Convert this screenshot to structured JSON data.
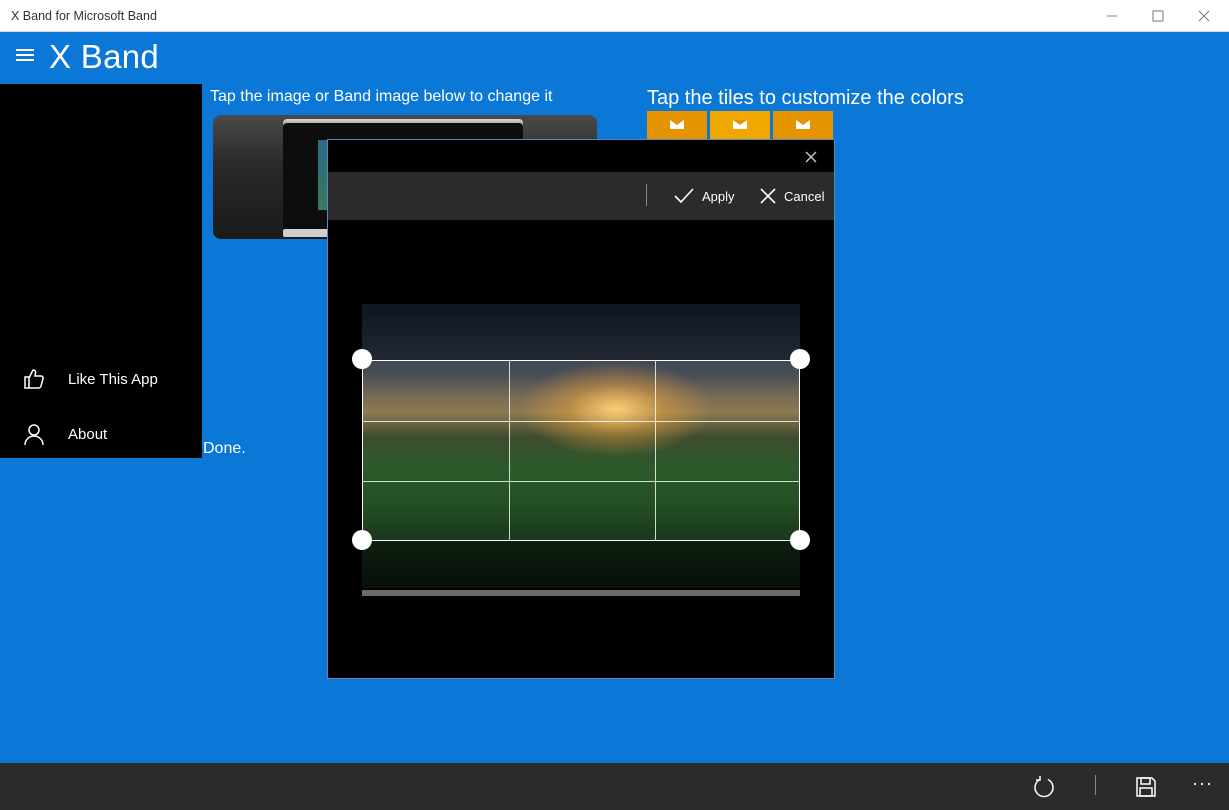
{
  "window": {
    "title": "X Band for Microsoft Band",
    "controls": [
      "minimize-icon",
      "maximize-icon",
      "close-icon"
    ]
  },
  "header": {
    "menu_icon": "hamburger-icon",
    "app_title": "X Band"
  },
  "nav": {
    "items": [
      {
        "label": "Like This App",
        "icon": "thumbs-up-icon"
      },
      {
        "label": "About",
        "icon": "person-icon"
      }
    ]
  },
  "main": {
    "image_instruction": "Tap the image or Band image below to change it",
    "tiles_instruction": "Tap the tiles to customize the colors",
    "status_text": "Done.",
    "tile_colors": [
      "#e59400",
      "#f0a800",
      "#e59400"
    ],
    "tile_icon": "envelope-icon"
  },
  "crop_dialog": {
    "close_icon": "close-icon",
    "apply_label": "Apply",
    "cancel_label": "Cancel"
  },
  "appbar": {
    "buttons": [
      "refresh-icon",
      "save-icon",
      "more-icon"
    ],
    "more_label": "···"
  },
  "colors": {
    "background": "#0b78d7",
    "nav_pane": "#000000",
    "toolbar": "#2b2b2b"
  }
}
